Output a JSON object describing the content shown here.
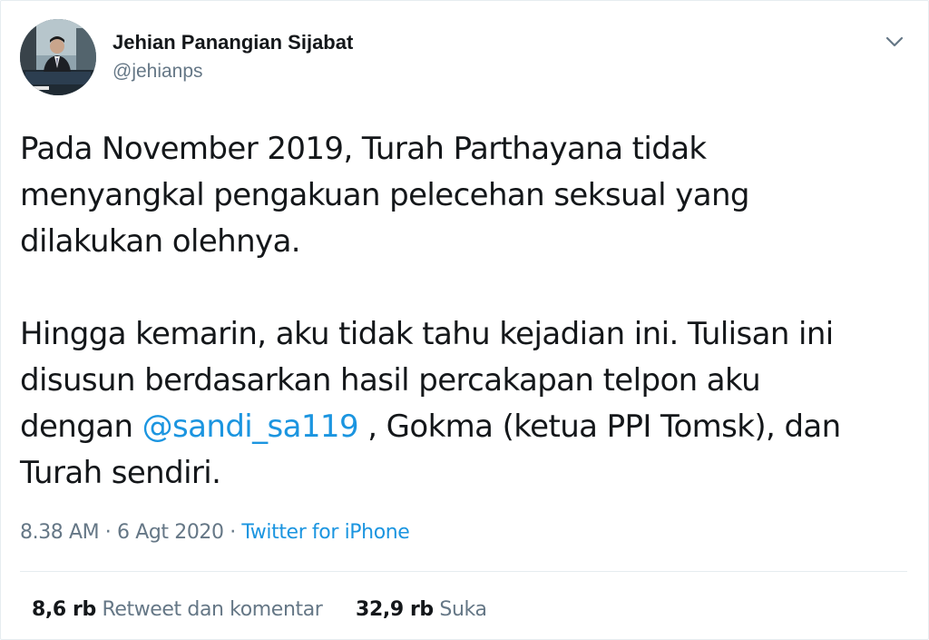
{
  "author": {
    "display_name": "Jehian Panangian Sijabat",
    "handle": "@jehianps"
  },
  "tweet": {
    "line1": "Pada November 2019, Turah Parthayana tidak",
    "line2": "menyangkal pengakuan pelecehan seksual yang",
    "line3": "dilakukan olehnya.",
    "line4": "Hingga kemarin, aku tidak tahu kejadian ini. Tulisan ini",
    "line5": "disusun berdasarkan hasil percakapan telpon aku",
    "line6_before": "dengan ",
    "line6_mention": "@sandi_sa119",
    "line6_after": " , Gokma (ketua PPI Tomsk), dan",
    "line7": "Turah sendiri."
  },
  "meta": {
    "time": "8.38 AM",
    "separator1": " · ",
    "date": "6 Agt 2020",
    "separator2": " · ",
    "source": "Twitter for iPhone"
  },
  "stats": {
    "retweets_count": "8,6 rb",
    "retweets_label": "Retweet dan komentar",
    "likes_count": "32,9 rb",
    "likes_label": "Suka"
  },
  "icons": {
    "avatar": "profile-photo",
    "caret": "chevron-down-icon"
  },
  "colors": {
    "link": "#1b95e0",
    "secondary_text": "#657786",
    "primary_text": "#14171a",
    "border": "#e6ecf0"
  }
}
